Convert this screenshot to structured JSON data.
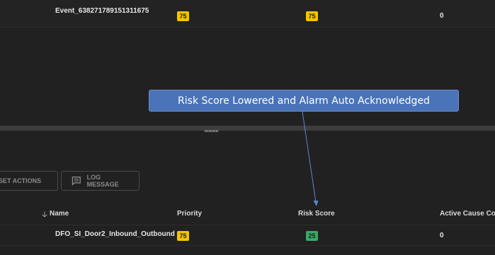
{
  "top_row": {
    "name": "Event_638271789151311675",
    "priority": "75",
    "risk_score": "75",
    "active_cause_count": "0"
  },
  "toolbar": {
    "reset_actions_label": "SET ACTIONS",
    "log_message_label": "LOG MESSAGE"
  },
  "table": {
    "columns": {
      "name": "Name",
      "priority": "Priority",
      "risk_score": "Risk Score",
      "active_cause_count": "Active Cause Coun"
    },
    "rows": [
      {
        "name": "DFO_SI_Door2_Inbound_Outbound",
        "priority": "75",
        "risk_score": "25",
        "active_cause_count": "0"
      }
    ]
  },
  "callout": {
    "text": "Risk Score Lowered and Alarm Auto Acknowledged"
  },
  "colors": {
    "background": "#212121",
    "priority_badge": "#f5c400",
    "risk_badge_low": "#3ba767",
    "callout": "#4a73b8"
  },
  "icons": {
    "sort": "arrow-down-icon",
    "log_message": "message-icon",
    "splitter": "grip-icon"
  }
}
